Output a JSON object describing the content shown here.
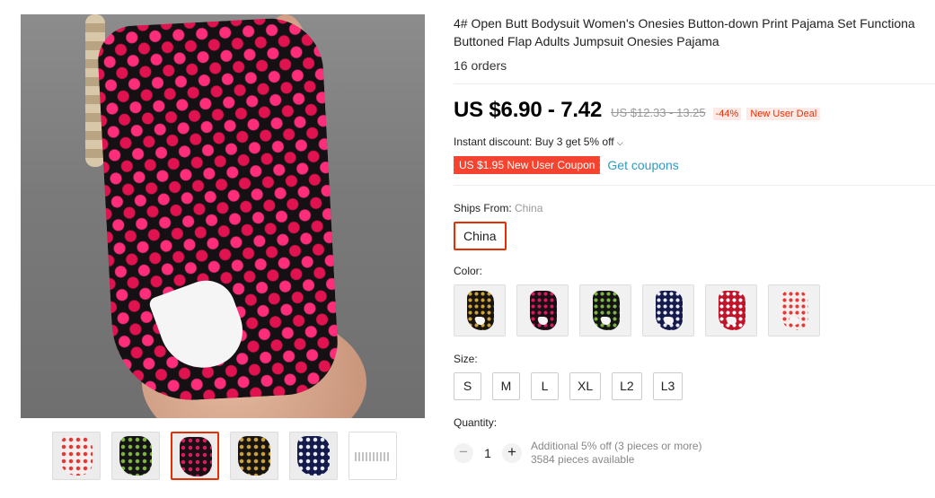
{
  "product": {
    "title": "4# Open Butt Bodysuit Women's Onesies Button-down Print Pajama Set Functiona",
    "title_line2": "Buttoned Flap Adults Jumpsuit Onesies Pajama",
    "orders": "16 orders"
  },
  "pricing": {
    "price": "US $6.90 - 7.42",
    "original_price": "US $12.33 - 13.25",
    "discount": "-44%",
    "deal_badge": "New User Deal",
    "instant_discount": "Instant discount: Buy 3 get 5% off",
    "coupon": "US $1.95 New User Coupon",
    "get_coupons": "Get coupons"
  },
  "ships_from": {
    "label": "Ships From: ",
    "value": "China",
    "option": "China"
  },
  "color": {
    "label": "Color:",
    "swatches": [
      {
        "name": "black-gold-hearts",
        "base": "#1a1410",
        "dot": "#c9a23a"
      },
      {
        "name": "black-pink-hearts",
        "base": "#1a1014",
        "dot": "#d81b60"
      },
      {
        "name": "black-multicolor-hearts",
        "base": "#141414",
        "dot": "#7cb342"
      },
      {
        "name": "navy-hearts",
        "base": "#141a4a",
        "dot": "#e8e8ff"
      },
      {
        "name": "red-hearts",
        "base": "#c0142a",
        "dot": "#ffffff"
      },
      {
        "name": "white-red-hearts",
        "base": "#f5eeee",
        "dot": "#e53935"
      }
    ]
  },
  "size": {
    "label": "Size:",
    "options": [
      "S",
      "M",
      "L",
      "XL",
      "L2",
      "L3"
    ]
  },
  "quantity": {
    "label": "Quantity:",
    "minus": "−",
    "value": "1",
    "plus": "+",
    "note1": "Additional 5% off (3 pieces or more)",
    "note2": "3584 pieces available"
  },
  "gallery": {
    "thumbs": [
      {
        "name": "white-red",
        "base": "#f5eeee",
        "dot": "#e53935"
      },
      {
        "name": "black-multicolor",
        "base": "#141414",
        "dot": "#7cb342"
      },
      {
        "name": "black-pink",
        "base": "#1a1014",
        "dot": "#d81b60"
      },
      {
        "name": "black-gold",
        "base": "#1a1410",
        "dot": "#c9a23a"
      },
      {
        "name": "navy",
        "base": "#141a4a",
        "dot": "#e8e8ff"
      },
      {
        "name": "size-chart",
        "base": "#ffffff",
        "dot": "#ffffff"
      }
    ],
    "active_index": 2
  }
}
